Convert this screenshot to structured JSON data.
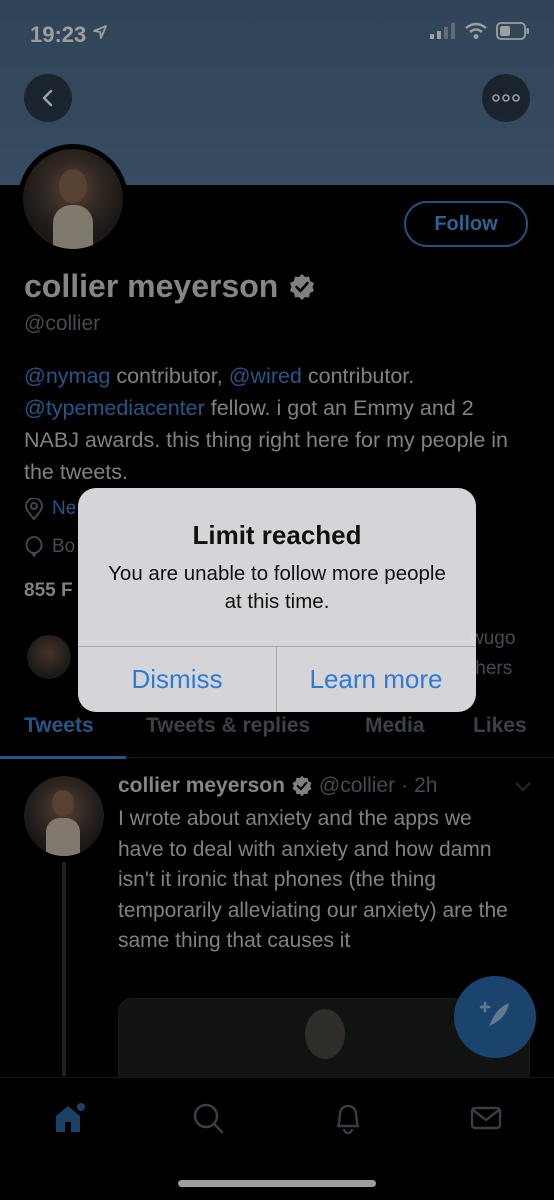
{
  "status_bar": {
    "time": "19:23"
  },
  "profile": {
    "follow_label": "Follow",
    "name": "collier meyerson",
    "handle": "@collier",
    "bio": {
      "link1": "@nymag",
      "text1": " contributor, ",
      "link2": "@wired",
      "text2": " contributor. ",
      "link3": "@typemediacenter",
      "text3": " fellow. i got an Emmy and 2 NABJ awards. this thing right here for my people in the tweets."
    },
    "location_partial": "Ne",
    "born_partial": "Bo",
    "stats_partial": "855 F",
    "followed_by_partial_1": "wugo",
    "followed_by_partial_2": "thers"
  },
  "tabs": [
    {
      "label": "Tweets"
    },
    {
      "label": "Tweets & replies"
    },
    {
      "label": "Media"
    },
    {
      "label": "Likes"
    }
  ],
  "tweet": {
    "name": "collier meyerson",
    "handle": "@collier",
    "separator": "·",
    "time": "2h",
    "text": "I wrote about anxiety and the apps we have to deal with anxiety and how damn isn't it ironic that phones (the thing temporarily alleviating our anxiety) are the same thing that causes it"
  },
  "alert": {
    "title": "Limit reached",
    "message": "You are unable to follow more people at this time.",
    "dismiss_label": "Dismiss",
    "learn_more_label": "Learn more"
  },
  "colors": {
    "accent": "#3f8ad6",
    "banner": "#587b9d",
    "alert_button": "#2d7bd6"
  },
  "icons": [
    "chevron-left-icon",
    "more-dots-icon",
    "verified-icon",
    "location-icon",
    "balloon-icon",
    "chevron-down-icon",
    "compose-icon",
    "home-icon",
    "search-icon",
    "notifications-icon",
    "messages-icon"
  ]
}
